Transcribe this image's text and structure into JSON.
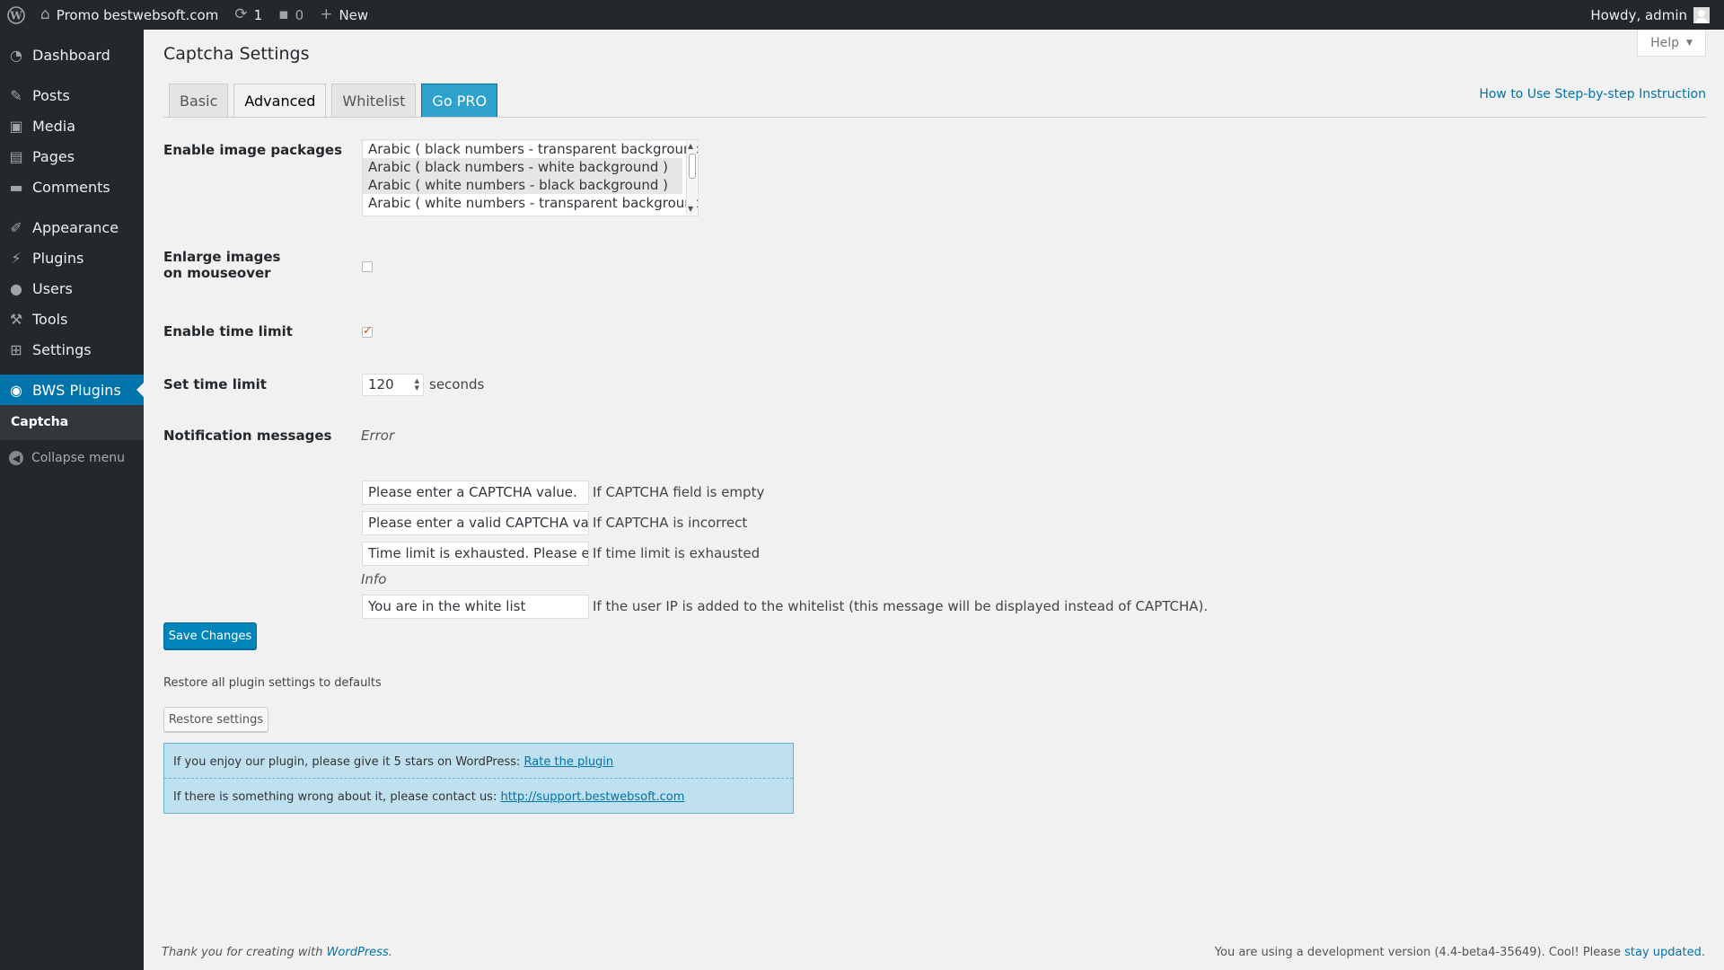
{
  "adminbar": {
    "site_name": "Promo bestwebsoft.com",
    "updates_count": "1",
    "comments_count": "0",
    "new_label": "New",
    "howdy": "Howdy, admin"
  },
  "sidebar": {
    "items": [
      {
        "label": "Dashboard",
        "icon": "dashboard-icon"
      },
      {
        "label": "Posts",
        "icon": "pin-icon"
      },
      {
        "label": "Media",
        "icon": "media-icon"
      },
      {
        "label": "Pages",
        "icon": "pages-icon"
      },
      {
        "label": "Comments",
        "icon": "comment-icon"
      },
      {
        "label": "Appearance",
        "icon": "brush-icon"
      },
      {
        "label": "Plugins",
        "icon": "plugin-icon"
      },
      {
        "label": "Users",
        "icon": "user-icon"
      },
      {
        "label": "Tools",
        "icon": "wrench-icon"
      },
      {
        "label": "Settings",
        "icon": "settings-icon"
      },
      {
        "label": "BWS Plugins",
        "icon": "bws-icon"
      }
    ],
    "submenu": {
      "label": "Captcha"
    },
    "collapse": "Collapse menu"
  },
  "page": {
    "title": "Captcha Settings",
    "help": "Help",
    "howto_link": "How to Use Step-by-step Instruction"
  },
  "tabs": [
    {
      "label": "Basic"
    },
    {
      "label": "Advanced"
    },
    {
      "label": "Whitelist"
    },
    {
      "label": "Go PRO"
    }
  ],
  "settings": {
    "image_packages": {
      "label": "Enable image packages",
      "options": [
        {
          "text": "Arabic ( black numbers - transparent background )",
          "selected": false
        },
        {
          "text": "Arabic ( black numbers - white background )",
          "selected": true
        },
        {
          "text": "Arabic ( white numbers - black background )",
          "selected": true
        },
        {
          "text": "Arabic ( white numbers - transparent background )",
          "selected": false
        }
      ]
    },
    "enlarge": {
      "label": "Enable images on mouseover",
      "label_text": "Enlarge images on mouseover",
      "checked": false
    },
    "time_limit_enable": {
      "label": "Enable time limit",
      "checked": true
    },
    "time_limit": {
      "label": "Set time limit",
      "value": "120",
      "suffix": "seconds"
    },
    "notifications": {
      "label": "Notification messages",
      "error_heading": "Error",
      "info_heading": "Info",
      "errors": [
        {
          "value": "Please enter a CAPTCHA value.",
          "desc": "If CAPTCHA field is empty"
        },
        {
          "value": "Please enter a valid CAPTCHA value.",
          "desc": "If CAPTCHA is incorrect"
        },
        {
          "value": "Time limit is exhausted. Please ente",
          "desc": "If time limit is exhausted"
        }
      ],
      "info": {
        "value": "You are in the white list",
        "desc": "If the user IP is added to the whitelist (this message will be displayed instead of CAPTCHA)."
      }
    }
  },
  "actions": {
    "save": "Save Changes",
    "restore_text": "Restore all plugin settings to defaults",
    "restore": "Restore settings"
  },
  "notice": {
    "line1_text": "If you enjoy our plugin, please give it 5 stars on WordPress: ",
    "line1_link": "Rate the plugin",
    "line2_text": "If there is something wrong about it, please contact us: ",
    "line2_link": "http://support.bestwebsoft.com"
  },
  "footer": {
    "left_text": "Thank you for creating with ",
    "left_link": "WordPress",
    "left_end": ".",
    "right_text": "You are using a development version (4.4-beta4-35649). Cool! Please ",
    "right_link": "stay updated",
    "right_end": "."
  },
  "colors": {
    "accent": "#0073aa",
    "button": "#0085ba",
    "sidebar": "#23282d",
    "notice_bg": "#bfe0ee"
  }
}
